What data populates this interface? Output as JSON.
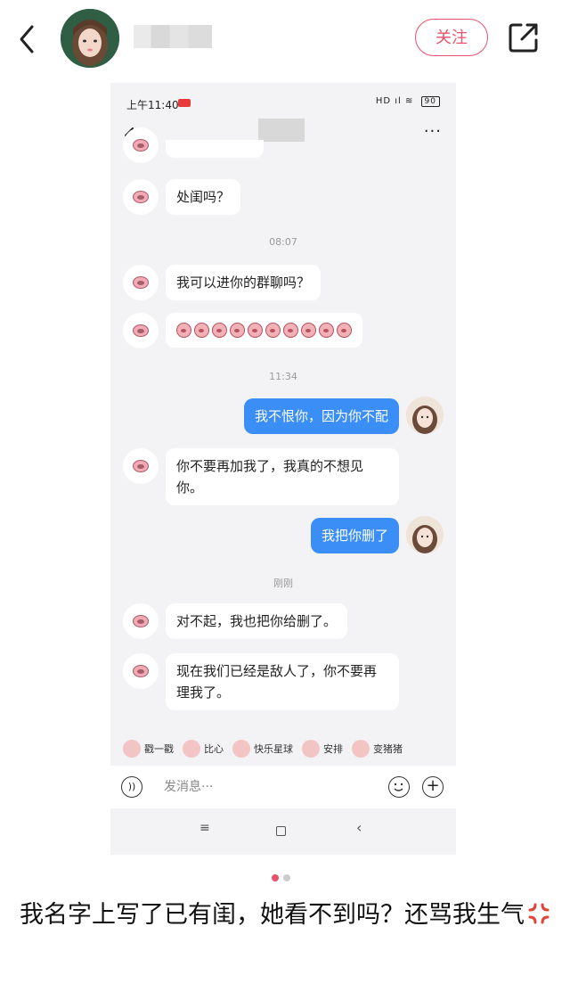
{
  "header": {
    "follow_label": "关注"
  },
  "screenshot": {
    "status_time": "上午11:40",
    "status_icons": "HD ıl ≋",
    "battery": "90",
    "messages": {
      "m1": "处闺吗？",
      "ts1": "08:07",
      "m2": "我可以进你的群聊吗？",
      "ts2": "11:34",
      "m3": "我不恨你，因为你不配",
      "m4": "你不要再加我了，我真的不想见你。",
      "m5": "我把你删了",
      "ts3": "刚刚",
      "m6": "对不起，我也把你给删了。",
      "m7": "现在我们已经是敌人了，你不要再理我了。"
    },
    "quick_actions": [
      "戳一戳",
      "比心",
      "快乐星球",
      "安排",
      "变猪猪"
    ],
    "input_placeholder": "发消息···",
    "nav": {
      "menu": "≡",
      "back": "‹"
    }
  },
  "caption": {
    "text": "我名字上写了已有闺，她看不到吗？还骂我生气"
  },
  "carousel": {
    "current": 1,
    "total": 2
  },
  "colors": {
    "accent": "#e7536b",
    "bubble_out": "#3a8ef6"
  }
}
